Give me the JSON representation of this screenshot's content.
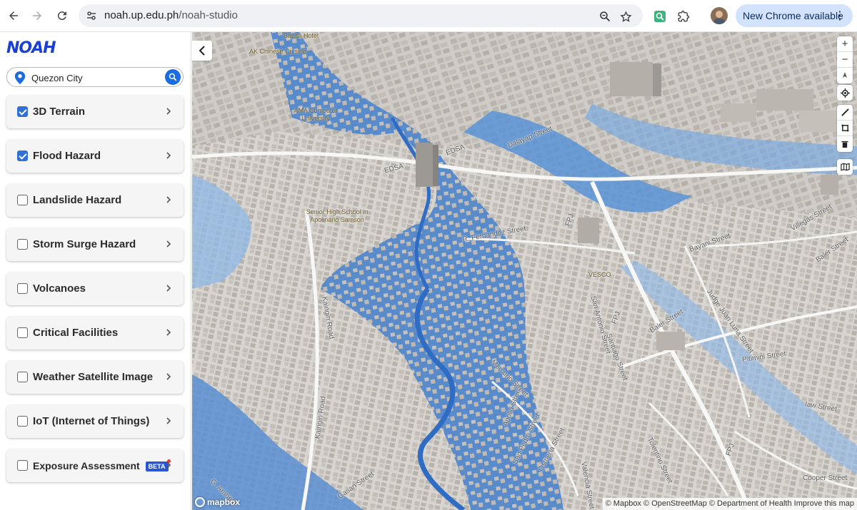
{
  "browser": {
    "url_host": "noah.up.edu.ph",
    "url_path": "/noah-studio",
    "update_label": "New Chrome available",
    "icons": [
      "back-icon",
      "forward-icon",
      "reload-icon",
      "site-settings-icon",
      "zoom-icon",
      "bookmark-star-icon",
      "extension-icon",
      "puzzle-icon",
      "profile-avatar",
      "menu-dots-icon"
    ]
  },
  "sidebar": {
    "logo_text": "NOAH",
    "search": {
      "value": "Quezon City",
      "placeholder": ""
    },
    "layers": [
      {
        "label": "3D Terrain",
        "checked": true
      },
      {
        "label": "Flood Hazard",
        "checked": true
      },
      {
        "label": "Landslide Hazard",
        "checked": false
      },
      {
        "label": "Storm Surge Hazard",
        "checked": false
      },
      {
        "label": "Volcanoes",
        "checked": false
      },
      {
        "label": "Critical Facilities",
        "checked": false
      },
      {
        "label": "Weather Satellite Image",
        "checked": false
      },
      {
        "label": "IoT (Internet of Things)",
        "checked": false
      },
      {
        "label": "Exposure Assessment",
        "checked": false,
        "badge": "BETA"
      }
    ]
  },
  "map": {
    "streets": [
      "EDSA",
      "EDSA",
      "Kaingin Road",
      "Kaingin Road",
      "R. Fernandez Street",
      "FPJ",
      "FPJ",
      "FPJ",
      "Baler Street",
      "Baler Street",
      "Pitimini Street",
      "Judge Juan Luna Street",
      "Bayani Street",
      "Villegas Street",
      "Apollo Street",
      "Mercurio Street",
      "San Pedro Street",
      "Osmeña Street",
      "Valencia Street",
      "Tolentino Street",
      "San Antonio Street",
      "Santiago Street",
      "Cooper Street",
      "Iaw Street",
      "Gasan Street",
      "G. Araneta"
    ],
    "pois": [
      "AK Chinese Cuisine",
      "Baesa Hotel",
      "AMA Computer University",
      "Senior High School in Apolinario Samson",
      "VESCO",
      "Dalayap Street"
    ],
    "attribution": "© Mapbox © OpenStreetMap © Department of Health Improve this map",
    "brand": "mapbox",
    "accent_flood": "#3d7fd0",
    "accent_flood_light": "#8fb8e6"
  }
}
